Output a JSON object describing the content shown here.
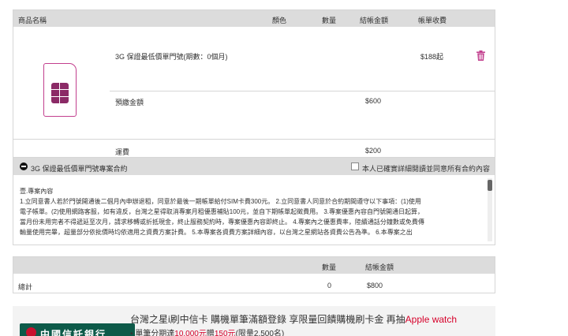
{
  "cart": {
    "headers": {
      "product": "商品名稱",
      "color": "顏色",
      "qty": "數量",
      "amount": "結帳金額",
      "fee": "帳單收費"
    },
    "product_name": "3G 保證最低價單門號(期數：0個月)",
    "product_fee": "$188起",
    "prepay_label": "預繳金額",
    "prepay_amount": "$600",
    "shipping_label": "運費",
    "shipping_amount": "$200"
  },
  "contract": {
    "title": "3G 保證最低價單門號專案合約",
    "agree_label": "本人已確實詳細閱讀並同意所有合約內容",
    "body_lines": [
      "壹.專案內容",
      "1.立同意書人若於門號開通後二個月內申辦退租，同意於最後一期帳單給付SIM卡費300元。 2.立同意書人同意於合約期間遵守以下事項：(1)使用",
      "電子帳單。(2)使用網路客服，如有違反，台灣之星得取消專案月租優惠補貼100元，並自下期帳單起徵費用。 3.專案優惠內容自門號開通日起算，",
      "當月份未用完者不得遞延至次月，請求移轉或折抵現金，終止服務契約時，專案優惠內容即終止。 4.專案內之優惠費率，陸續通話分鐘數或免費傳",
      "輸量使用完畢，超量部分依批價時均依適用之資費方案計費。 5.本專案各資費方案詳細內容，以台灣之星網站各資費公告為準。 6.本專案之出"
    ]
  },
  "summary": {
    "qty_header": "數量",
    "amount_header": "結帳金額",
    "total_label": "總計",
    "qty": "0",
    "amount": "$800"
  },
  "banner": {
    "bank_name": "中國信託銀行",
    "title_main": "台灣之星i刷中信卡 購機單筆滿額登錄 享限量回饋購機刷卡金 再抽",
    "title_red": "Apple watch",
    "line2_prefix": "• 單筆分期達",
    "line2_amount": "10,000元",
    "line2_mid": "贈",
    "line2_bonus": "150元",
    "line2_suffix": "(限量2,500名)"
  },
  "colors": {
    "accent": "#c23f8e",
    "header_bg": "#dcdcdc",
    "promo_red": "#d6002a",
    "bank_green": "#0d5a49"
  }
}
